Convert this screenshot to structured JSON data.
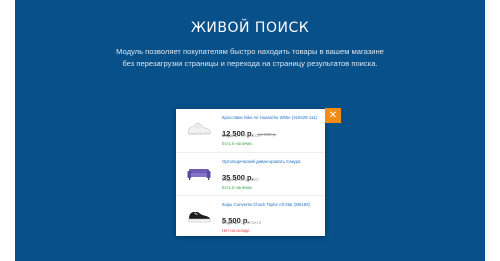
{
  "header": {
    "title": "ЖИВОЙ ПОИСК",
    "description_line1": "Модуль позволяет покупателям быстро находить товары в вашем магазине",
    "description_line2": "без перезагрузки страницы и перехода на страницу результатов поиска."
  },
  "popup": {
    "close_label": "✕",
    "model_label": "Модель:",
    "items": [
      {
        "name": "Кроссовки Nike Air Huarache White (318429-111)",
        "price": "12 500 р.",
        "old_price": "15 000 р.",
        "model_value": "AirHuaC03",
        "stock": "Есть в наличии",
        "stock_color": "#3aa84a",
        "icon": "sneaker-icon"
      },
      {
        "name": "Ортопедический диван-кровать Сакура",
        "price": "35 500 р.",
        "old_price": "",
        "model_value": "divan0200",
        "stock": "Есть в наличии",
        "stock_color": "#3aa84a",
        "icon": "sofa-icon"
      },
      {
        "name": "Кеды Converse Chuck Taylor All Star (M9160)",
        "price": "5 500 р.",
        "old_price": "",
        "model_value": "converse15",
        "stock": "Нет на складе",
        "stock_color": "#e04040",
        "icon": "converse-shoe-icon"
      }
    ]
  },
  "colors": {
    "banner_bg": "#075089",
    "close_bg": "#f28c12",
    "link": "#1a6fc9"
  }
}
